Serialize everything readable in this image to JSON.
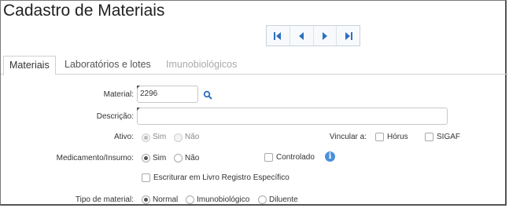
{
  "page": {
    "title": "Cadastro de Materiais"
  },
  "pager": {
    "icons": [
      "first-page-icon",
      "previous-page-icon",
      "next-page-icon",
      "last-page-icon"
    ]
  },
  "tabs": [
    {
      "label": "Materiais",
      "state": "active"
    },
    {
      "label": "Laboratórios e lotes",
      "state": "normal"
    },
    {
      "label": "Imunobiológicos",
      "state": "disabled"
    }
  ],
  "form": {
    "material": {
      "label": "Material:",
      "value": "2296"
    },
    "descricao": {
      "label": "Descrição:",
      "value": ""
    },
    "ativo": {
      "label": "Ativo:",
      "options": [
        "Sim",
        "Não"
      ],
      "selected": "Sim",
      "disabled": true
    },
    "vincular": {
      "label": "Vincular a:",
      "options": [
        "Hórus",
        "SIGAF"
      ]
    },
    "medicamento": {
      "label": "Medicamento/Insumo:",
      "options": [
        "Sim",
        "Não"
      ],
      "selected": "Sim"
    },
    "controlado": {
      "label": "Controlado"
    },
    "escriturar": {
      "label": "Escriturar em Livro Registro Específico"
    },
    "tipo": {
      "label": "Tipo de material:",
      "options": [
        "Normal",
        "Imunobiológico",
        "Diluente"
      ],
      "selected": "Normal"
    }
  },
  "colors": {
    "accent": "#2c6fc0",
    "info": "#4a90d9"
  }
}
